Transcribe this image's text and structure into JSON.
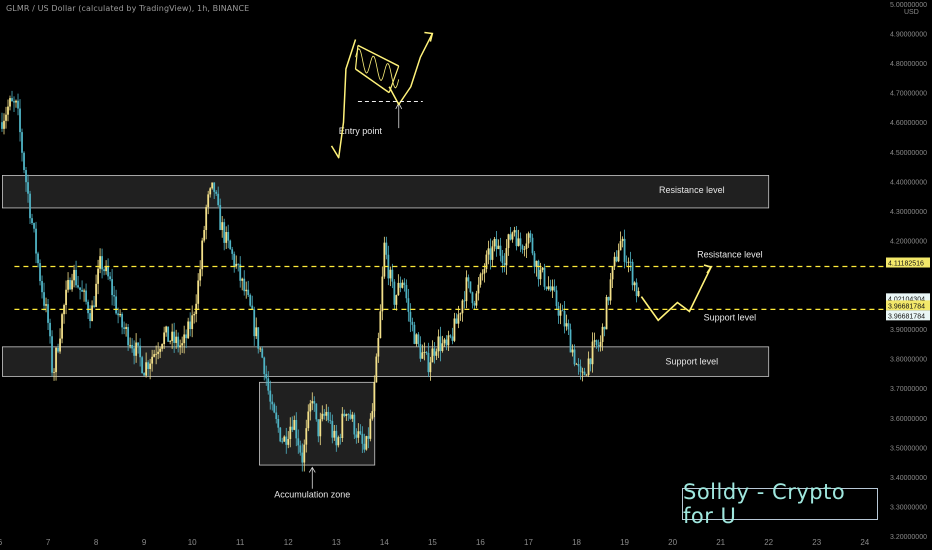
{
  "header": {
    "title": "GLMR / US Dollar (calculated by TradingView), 1h, BINANCE"
  },
  "branding": {
    "text": "Solldy - Crypto for U"
  },
  "colors": {
    "background": "#000000",
    "up_candle": "#f3e08a",
    "down_candle": "#4fb3c4",
    "zone_fill": "#3a3a3a",
    "zone_border": "#c9c9c9",
    "dashed_line": "#ffeb3b",
    "drawing": "#fff27a",
    "axis_text": "#8a8a8a",
    "price_label_bg": "#f3e86a",
    "price_label_bg2": "#e9f6f6"
  },
  "chart_data": {
    "type": "candlestick",
    "pair": "GLMR / US Dollar",
    "timeframe": "1h",
    "exchange": "BINANCE",
    "ylim": [
      3.2,
      5.0
    ],
    "y_axis_unit": "USD",
    "y_ticks": [
      {
        "v": 3.2,
        "label": "3.20000000"
      },
      {
        "v": 3.3,
        "label": "3.30000000"
      },
      {
        "v": 3.4,
        "label": "3.40000000"
      },
      {
        "v": 3.5,
        "label": "3.50000000"
      },
      {
        "v": 3.6,
        "label": "3.60000000"
      },
      {
        "v": 3.7,
        "label": "3.70000000"
      },
      {
        "v": 3.8,
        "label": "3.80000000"
      },
      {
        "v": 3.9,
        "label": "3.90000000"
      },
      {
        "v": 4.2,
        "label": "4.20000000"
      },
      {
        "v": 4.3,
        "label": "4.30000000"
      },
      {
        "v": 4.4,
        "label": "4.40000000"
      },
      {
        "v": 4.5,
        "label": "4.50000000"
      },
      {
        "v": 4.6,
        "label": "4.60000000"
      },
      {
        "v": 4.7,
        "label": "4.70000000"
      },
      {
        "v": 4.8,
        "label": "4.80000000"
      },
      {
        "v": 4.9,
        "label": "4.90000000"
      },
      {
        "v": 5.0,
        "label": "5.00000000"
      }
    ],
    "x_ticks": [
      "6",
      "7",
      "8",
      "9",
      "10",
      "11",
      "12",
      "13",
      "14",
      "15",
      "16",
      "17",
      "18",
      "19",
      "20",
      "21",
      "22",
      "23",
      "24"
    ],
    "x_range": [
      6,
      24.4
    ],
    "price_labels": [
      {
        "value": 4.11182516,
        "text": "4.11182516",
        "style": "yellow"
      },
      {
        "value": 4.02104304,
        "text": "4.02104304",
        "style": "light"
      },
      {
        "value": 3.96681784,
        "text": "3.96681784",
        "style": "yellow"
      },
      {
        "value": 3.96681784,
        "text": "3.96681784",
        "style": "light"
      }
    ],
    "horizontal_lines": [
      {
        "value": 4.11182516,
        "label": "Resistance level",
        "label_x": 20.9
      },
      {
        "value": 3.96681784,
        "label": "Support level",
        "label_x": 20.9
      }
    ],
    "zones": [
      {
        "label": "Resistance level",
        "x0": 6.05,
        "x1": 22.0,
        "y0": 4.31,
        "y1": 4.42
      },
      {
        "label": "Support level",
        "x0": 6.05,
        "x1": 22.0,
        "y0": 3.74,
        "y1": 3.84
      },
      {
        "label": "Accumulation zone",
        "x0": 11.4,
        "x1": 13.8,
        "y0": 3.44,
        "y1": 3.72
      }
    ],
    "annotations": [
      {
        "text": "Entry point",
        "x": 13.5,
        "y": 4.56
      },
      {
        "text": "Accumulation zone",
        "x": 12.5,
        "y": 3.33
      },
      {
        "text": "Resistance level",
        "x": 20.4,
        "y": 4.37
      },
      {
        "text": "Support level",
        "x": 20.4,
        "y": 3.79
      }
    ],
    "price_path": [
      [
        6.0,
        4.6
      ],
      [
        6.2,
        4.66
      ],
      [
        6.35,
        4.65
      ],
      [
        6.5,
        4.45
      ],
      [
        6.7,
        4.22
      ],
      [
        6.85,
        4.06
      ],
      [
        7.0,
        3.92
      ],
      [
        7.1,
        3.74
      ],
      [
        7.3,
        3.95
      ],
      [
        7.5,
        4.1
      ],
      [
        7.7,
        4.02
      ],
      [
        7.9,
        3.95
      ],
      [
        8.1,
        4.13
      ],
      [
        8.3,
        4.05
      ],
      [
        8.5,
        3.92
      ],
      [
        8.7,
        3.87
      ],
      [
        9.0,
        3.77
      ],
      [
        9.2,
        3.82
      ],
      [
        9.4,
        3.88
      ],
      [
        9.6,
        3.86
      ],
      [
        9.8,
        3.84
      ],
      [
        10.0,
        3.93
      ],
      [
        10.15,
        4.08
      ],
      [
        10.3,
        4.32
      ],
      [
        10.45,
        4.38
      ],
      [
        10.55,
        4.28
      ],
      [
        10.7,
        4.2
      ],
      [
        10.9,
        4.12
      ],
      [
        11.1,
        4.02
      ],
      [
        11.2,
        3.97
      ],
      [
        11.3,
        3.9
      ],
      [
        11.5,
        3.78
      ],
      [
        11.65,
        3.62
      ],
      [
        11.9,
        3.52
      ],
      [
        12.1,
        3.6
      ],
      [
        12.3,
        3.46
      ],
      [
        12.5,
        3.68
      ],
      [
        12.6,
        3.55
      ],
      [
        12.8,
        3.62
      ],
      [
        13.0,
        3.5
      ],
      [
        13.2,
        3.64
      ],
      [
        13.35,
        3.58
      ],
      [
        13.6,
        3.48
      ],
      [
        13.75,
        3.62
      ],
      [
        13.9,
        3.9
      ],
      [
        14.0,
        4.18
      ],
      [
        14.2,
        4.0
      ],
      [
        14.4,
        4.08
      ],
      [
        14.5,
        3.95
      ],
      [
        14.7,
        3.84
      ],
      [
        14.9,
        3.78
      ],
      [
        15.1,
        3.86
      ],
      [
        15.3,
        3.83
      ],
      [
        15.5,
        3.92
      ],
      [
        15.7,
        4.05
      ],
      [
        15.9,
        4.0
      ],
      [
        16.1,
        4.12
      ],
      [
        16.3,
        4.18
      ],
      [
        16.5,
        4.15
      ],
      [
        16.7,
        4.25
      ],
      [
        16.8,
        4.18
      ],
      [
        17.0,
        4.22
      ],
      [
        17.2,
        4.1
      ],
      [
        17.4,
        4.05
      ],
      [
        17.6,
        3.98
      ],
      [
        17.8,
        3.9
      ],
      [
        18.0,
        3.78
      ],
      [
        18.1,
        3.72
      ],
      [
        18.3,
        3.82
      ],
      [
        18.5,
        3.85
      ],
      [
        18.7,
        4.05
      ],
      [
        18.9,
        4.2
      ],
      [
        19.1,
        4.12
      ],
      [
        19.3,
        4.0
      ]
    ],
    "projection_path": [
      [
        19.35,
        4.01
      ],
      [
        19.7,
        3.93
      ],
      [
        20.1,
        3.99
      ],
      [
        20.35,
        3.96
      ],
      [
        20.8,
        4.11
      ]
    ],
    "flag_drawing": {
      "pole": [
        [
          12.9,
          4.52
        ],
        [
          13.05,
          4.48
        ],
        [
          13.15,
          4.6
        ],
        [
          13.2,
          4.78
        ],
        [
          13.4,
          4.88
        ]
      ],
      "flag_upper": [
        [
          13.45,
          4.86
        ],
        [
          14.3,
          4.79
        ]
      ],
      "flag_lower": [
        [
          13.4,
          4.78
        ],
        [
          14.1,
          4.7
        ]
      ],
      "breakout": [
        [
          14.1,
          4.72
        ],
        [
          14.3,
          4.66
        ],
        [
          14.55,
          4.72
        ],
        [
          14.75,
          4.82
        ],
        [
          15.0,
          4.9
        ]
      ],
      "entry_dashed_y": 4.67
    }
  }
}
